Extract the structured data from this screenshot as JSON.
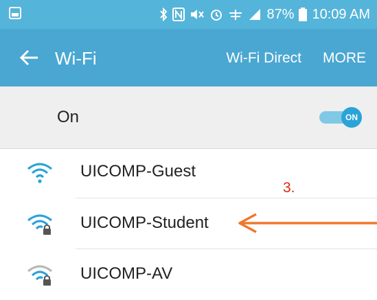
{
  "status_bar": {
    "battery_percent": "87%",
    "time": "10:09 AM",
    "icons": [
      "image-icon",
      "bluetooth-icon",
      "nfc-icon",
      "mute-icon",
      "alarm-icon",
      "data-icon",
      "signal-icon",
      "battery-icon"
    ]
  },
  "app_bar": {
    "title": "Wi-Fi",
    "wifi_direct": "Wi-Fi Direct",
    "more": "MORE"
  },
  "toggle_row": {
    "label": "On",
    "toggle_text": "ON"
  },
  "networks": [
    {
      "name": "UICOMP-Guest",
      "secured": false,
      "icon": "wifi-icon"
    },
    {
      "name": "UICOMP-Student",
      "secured": true,
      "icon": "wifi-lock-icon"
    },
    {
      "name": "UICOMP-AV",
      "secured": true,
      "icon": "wifi-lock-icon"
    }
  ],
  "annotation": {
    "step_label": "3.",
    "color": "#d62a10",
    "arrow_color": "#f0772b"
  },
  "colors": {
    "status_bar": "#55b4d9",
    "app_bar": "#4aa7d2",
    "accent": "#2aa3d8"
  }
}
